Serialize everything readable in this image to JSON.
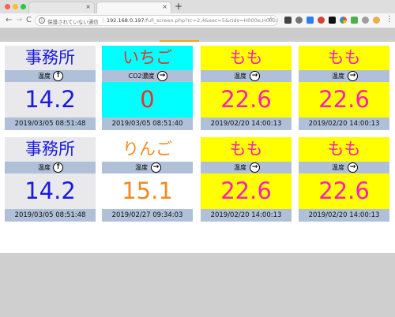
{
  "browser": {
    "tab_close_glyph": "×",
    "new_tab_glyph": "+",
    "security_text": "保護されていない通信",
    "url_host": "192.168.0.197",
    "url_path": "/full_screen.php?rc=2,4&sec=5&cids=H000e,H002a,H002b,H002...",
    "url_separator": "|",
    "info_glyph": "i",
    "back_glyph": "←",
    "forward_glyph": "→",
    "reload_glyph": "C",
    "star_glyph": "☆",
    "menu_glyph": "⋮"
  },
  "colors": {
    "bar": "#afc0d8",
    "blue_text": "#1a1adf",
    "red_text": "#e8332a",
    "magenta_text": "#ff1fb8",
    "orange_text": "#f08a1e",
    "panel_grey": "#e9e9ec",
    "cyan": "#00ffff",
    "yellow": "#ffff00",
    "white": "#ffffff"
  },
  "panels": [
    {
      "name": "事務所",
      "metric": "温度",
      "arrow": "up-arrow-icon",
      "arrow_glyph": "↑",
      "value": "14.2",
      "time": "2019/03/05 08:51:48"
    },
    {
      "name": "いちご",
      "metric": "CO2濃度",
      "arrow": "right-arrow-icon",
      "arrow_glyph": "→",
      "value": "0",
      "time": "2019/03/05 08:51:40"
    },
    {
      "name": "もも",
      "metric": "温度",
      "arrow": "right-arrow-icon",
      "arrow_glyph": "→",
      "value": "22.6",
      "time": "2019/02/20 14:00:13"
    },
    {
      "name": "もも",
      "metric": "温度",
      "arrow": "right-arrow-icon",
      "arrow_glyph": "→",
      "value": "22.6",
      "time": "2019/02/20 14:00:13"
    },
    {
      "name": "事務所",
      "metric": "温度",
      "arrow": "up-arrow-icon",
      "arrow_glyph": "↑",
      "value": "14.2",
      "time": "2019/03/05 08:51:48"
    },
    {
      "name": "りんご",
      "metric": "温度",
      "arrow": "right-arrow-icon",
      "arrow_glyph": "→",
      "value": "15.1",
      "time": "2019/02/27 09:34:03"
    },
    {
      "name": "もも",
      "metric": "温度",
      "arrow": "right-arrow-icon",
      "arrow_glyph": "→",
      "value": "22.6",
      "time": "2019/02/20 14:00:13"
    },
    {
      "name": "もも",
      "metric": "温度",
      "arrow": "right-arrow-icon",
      "arrow_glyph": "→",
      "value": "22.6",
      "time": "2019/02/20 14:00:13"
    }
  ]
}
